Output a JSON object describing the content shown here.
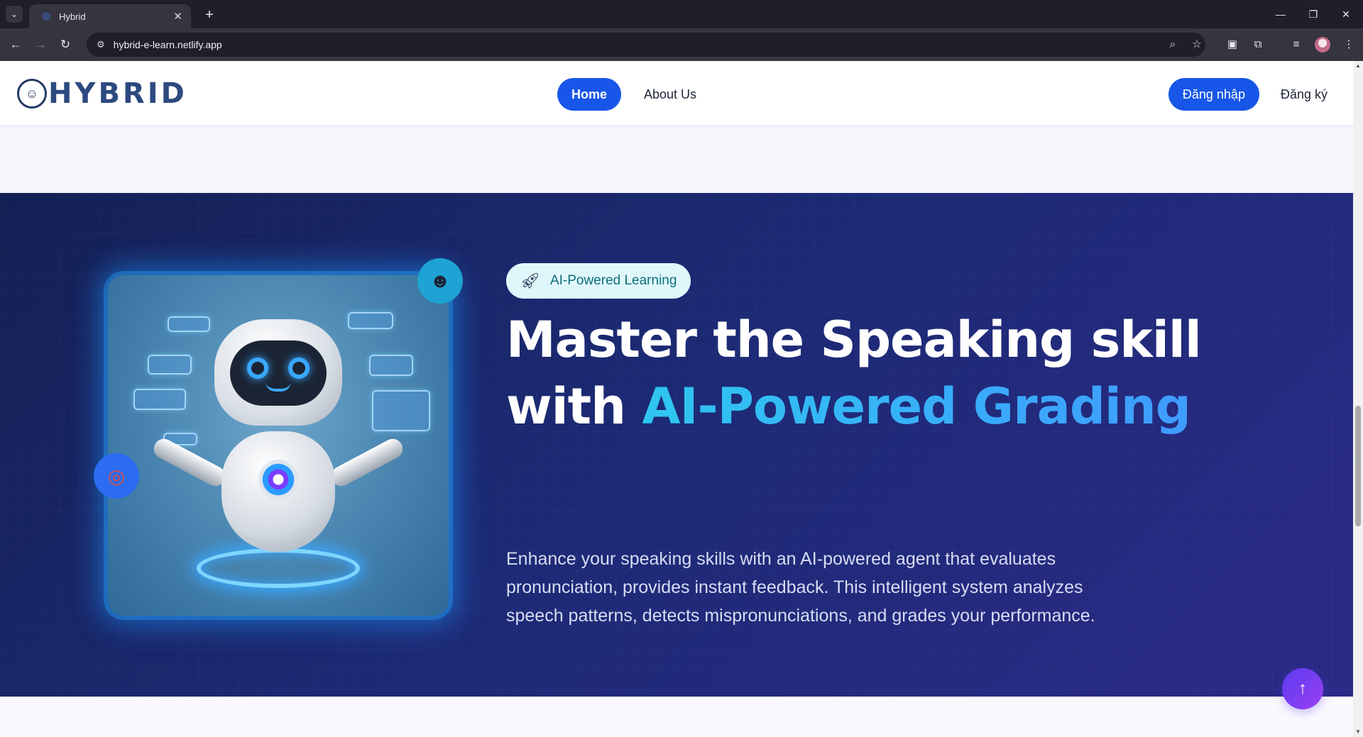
{
  "browser": {
    "tab_title": "Hybrid",
    "tab_close_glyph": "✕",
    "new_tab_glyph": "+",
    "url": "hybrid-e-learn.netlify.app",
    "icons": [
      "tab-search-icon",
      "back-arrow-icon",
      "forward-arrow-icon",
      "reload-icon",
      "site-info-icon",
      "zoom-icon",
      "bookmark-star-icon",
      "extension-icon",
      "puzzle-icon",
      "media-icon",
      "profile-avatar",
      "more-menu-icon",
      "minimize-icon",
      "restore-icon",
      "close-window-icon"
    ]
  },
  "header": {
    "logo_text": "HYBRID",
    "nav": {
      "home_label": "Home",
      "about_label": "About Us"
    },
    "login_label": "Đăng nhập",
    "register_label": "Đăng ký"
  },
  "hero": {
    "badge_label": "AI-Powered Learning",
    "badge_icon": "rocket-icon",
    "title_line1": "Master the Speaking skill",
    "title_line2_prefix": "with ",
    "title_line2_accent": "AI-Powered Grading",
    "description": "Enhance your speaking skills with an AI-powered agent that evaluates pronunciation, provides instant feedback. This intelligent system analyzes speech patterns, detects mispronunciations, and grades your performance.",
    "colors": {
      "background_start": "#142054",
      "background_end": "#2b2a86",
      "accent_start": "#2fc6f0",
      "accent_end": "#3f9bff",
      "badge_bg": "#dff7fb"
    }
  },
  "back_to_top_glyph": "↑",
  "colors": {
    "primary": "#1756e8"
  }
}
